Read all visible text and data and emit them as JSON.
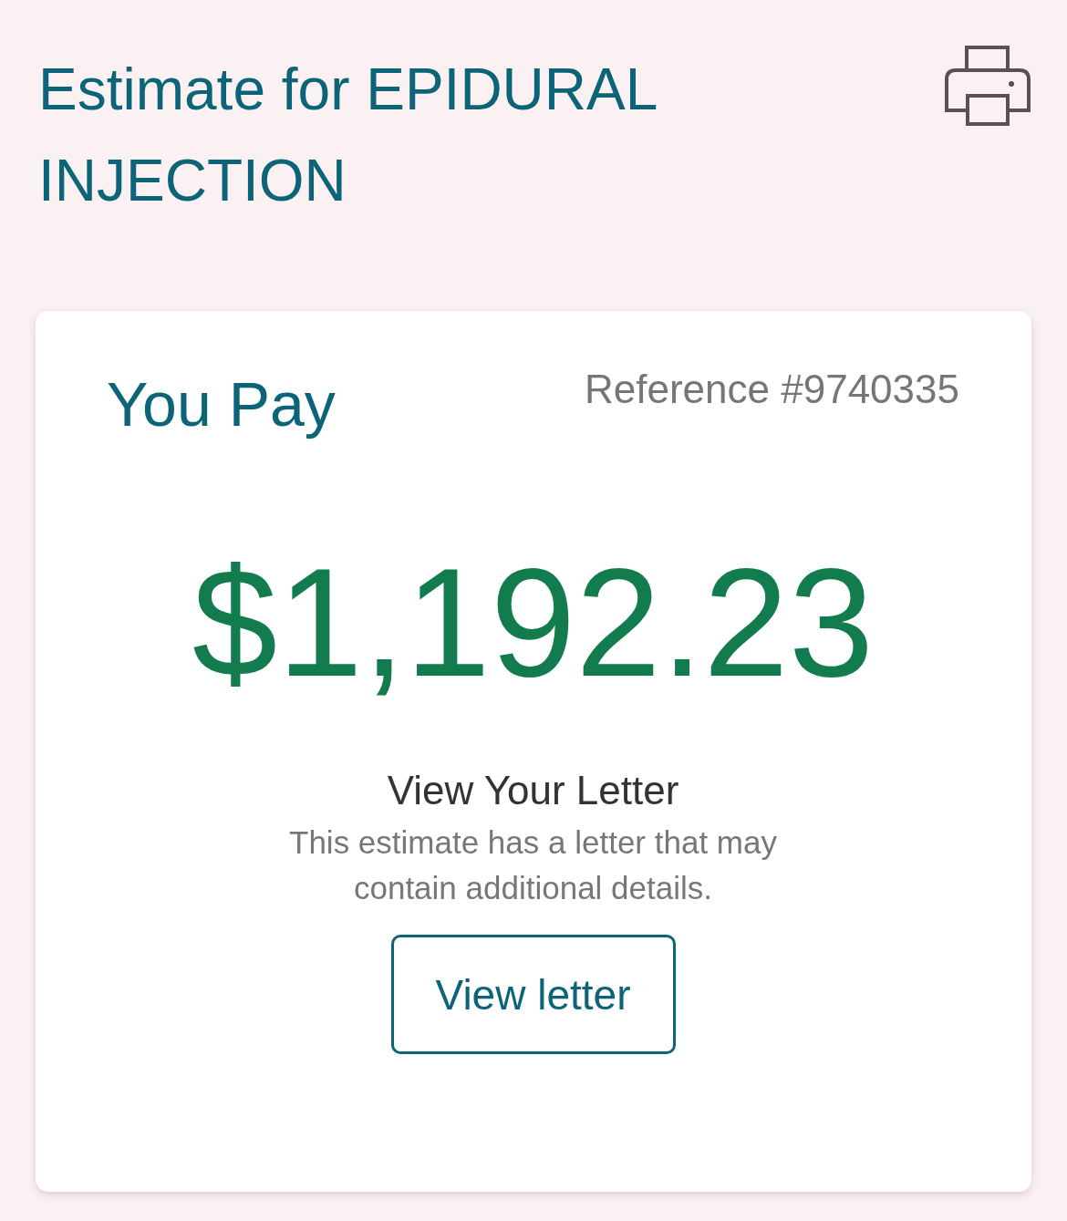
{
  "header": {
    "title": "Estimate for EPIDURAL INJECTION"
  },
  "card": {
    "heading": "You Pay",
    "reference": "Reference #9740335",
    "amount": "$1,192.23",
    "letter": {
      "title": "View Your Letter",
      "description": "This estimate has a letter that may contain additional details.",
      "button": "View letter"
    }
  }
}
